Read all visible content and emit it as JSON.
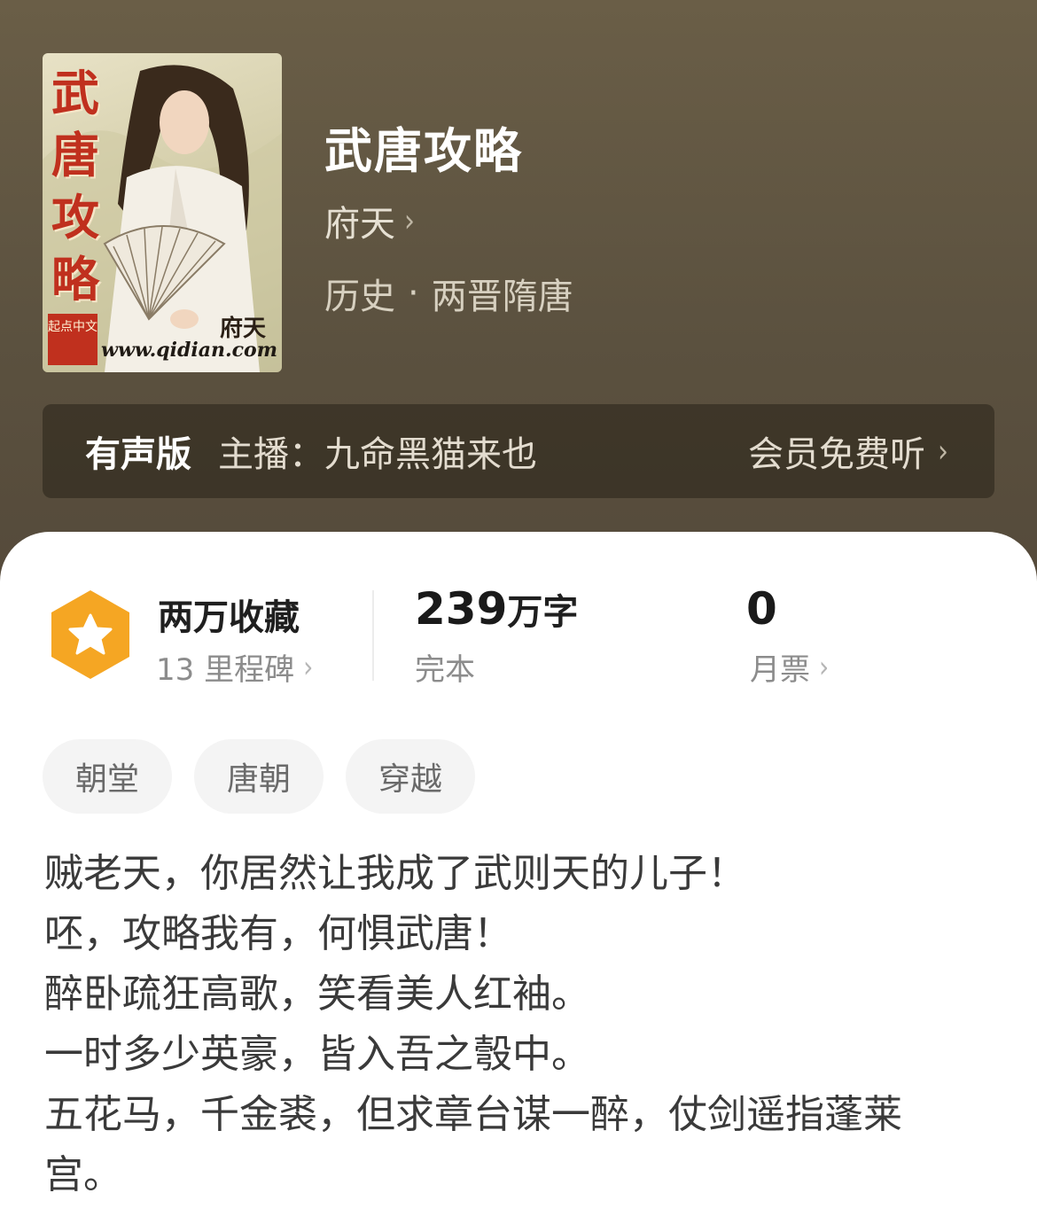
{
  "book": {
    "cover": {
      "title_chars": [
        "武",
        "唐",
        "攻",
        "略"
      ],
      "author_mark": "府天",
      "site": "www.qidian.com",
      "badge": "起点中文"
    },
    "title": "武唐攻略",
    "author": "府天",
    "category": "历史",
    "separator": "·",
    "subcategory": "两晋隋唐"
  },
  "audio": {
    "label": "有声版",
    "host": "主播：九命黑猫来也",
    "cta": "会员免费听"
  },
  "stats": {
    "collect_main": "两万收藏",
    "collect_sub": "13 里程碑",
    "words_number": "239",
    "words_unit": "万字",
    "status": "完本",
    "tickets_number": "0",
    "tickets_label": "月票"
  },
  "tags": [
    "朝堂",
    "唐朝",
    "穿越"
  ],
  "description": [
    "贼老天，你居然让我成了武则天的儿子！",
    "呸，攻略我有，何惧武唐！",
    "醉卧疏狂高歌，笑看美人红袖。",
    "一时多少英豪，皆入吾之彀中。",
    "五花马，千金裘，但求章台谋一醉，仗剑遥指蓬莱",
    "宫。"
  ],
  "icons": {
    "chevron": "chevron-right-icon",
    "badge": "star-hexagon-icon"
  },
  "colors": {
    "header_bg": "#5b513f",
    "badge_orange": "#f5a623",
    "text_dark": "#1f1f1f",
    "text_muted": "#8c8c8c"
  }
}
